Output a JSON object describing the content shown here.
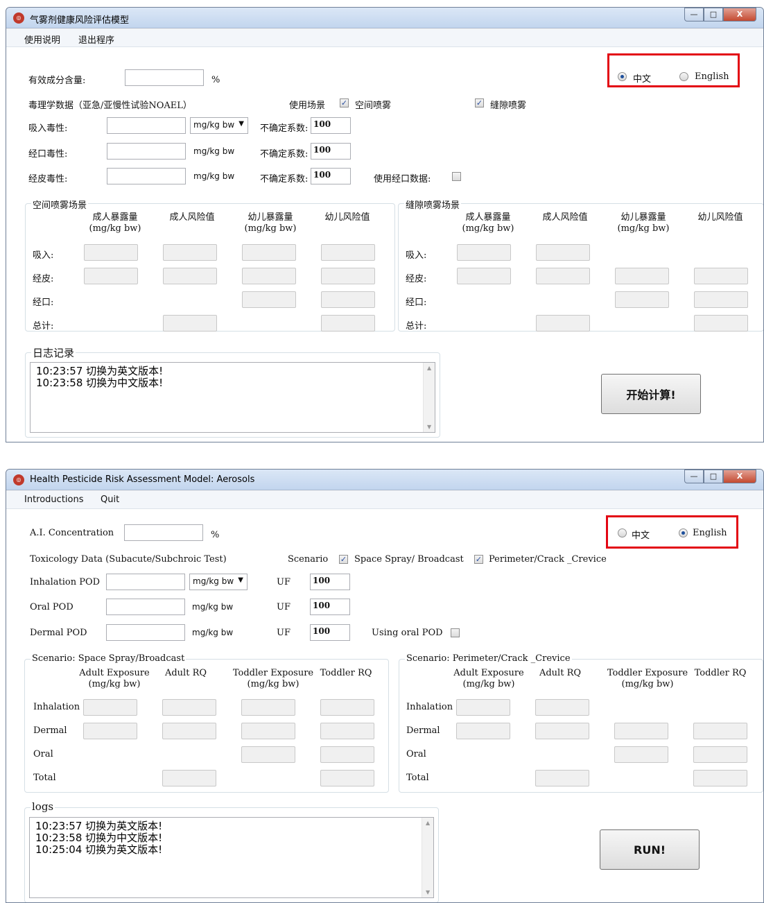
{
  "top": {
    "title": "气雾剂健康风险评估模型",
    "window_controls": {
      "min": "—",
      "max": "□",
      "close": "X"
    },
    "menu": [
      "使用说明",
      "退出程序"
    ],
    "ai_concentration": {
      "label": "有效成分含量:",
      "value": "",
      "unit": "%"
    },
    "lang": {
      "zh": "中文",
      "en": "English",
      "selected": "zh"
    },
    "tox_header": "毒理学数据（亚急/亚慢性试验NOAEL）",
    "scenario_label": "使用场景",
    "space_spray": "空间喷雾",
    "crack_spray": "缝隙喷雾",
    "inhalation": "吸入毒性:",
    "oral": "经口毒性:",
    "dermal": "经皮毒性:",
    "unit_combo": "mg/kg bw",
    "unit": "mg/kg bw",
    "uf_label": "不确定系数:",
    "uf_values": [
      "100",
      "100",
      "100"
    ],
    "use_oral": "使用经口数据:",
    "group1_title": "空间喷雾场景",
    "group2_title": "缝隙喷雾场景",
    "col_headers": [
      "成人暴露量\n(mg/kg bw)",
      "成人风险值",
      "幼儿暴露量\n(mg/kg bw)",
      "幼儿风险值"
    ],
    "row_labels": [
      "吸入:",
      "经皮:",
      "经口:",
      "总计:"
    ],
    "log_title": "日志记录",
    "logs": [
      "10:23:57 切换为英文版本!",
      "10:23:58 切换为中文版本!"
    ],
    "run": "开始计算!"
  },
  "bottom": {
    "title": "Health Pesticide Risk Assessment Model: Aerosols",
    "window_controls": {
      "min": "—",
      "max": "□",
      "close": "X"
    },
    "menu": [
      "Introductions",
      "Quit"
    ],
    "ai_concentration": {
      "label": "A.I. Concentration",
      "value": "",
      "unit": "%"
    },
    "lang": {
      "zh": "中文",
      "en": "English",
      "selected": "en"
    },
    "tox_header": "Toxicology Data (Subacute/Subchroic Test)",
    "scenario_label": "Scenario",
    "space_spray": "Space Spray/ Broadcast",
    "crack_spray": "Perimeter/Crack _Crevice",
    "inhalation": "Inhalation POD",
    "oral": "Oral POD",
    "dermal": "Dermal POD",
    "unit_combo": "mg/kg bw",
    "unit": "mg/kg bw",
    "uf_label": "UF",
    "uf_values": [
      "100",
      "100",
      "100"
    ],
    "use_oral": "Using oral POD",
    "group1_title": "Scenario: Space Spray/Broadcast",
    "group2_title": "Scenario: Perimeter/Crack _Crevice",
    "col_headers": [
      "Adult Exposure\n(mg/kg bw)",
      "Adult RQ",
      "Toddler Exposure\n(mg/kg bw)",
      "Toddler RQ"
    ],
    "row_labels": [
      "Inhalation",
      "Dermal",
      "Oral",
      "Total"
    ],
    "log_title": "logs",
    "logs": [
      "10:23:57 切换为英文版本!",
      "10:23:58 切换为中文版本!",
      "10:25:04 切换为英文版本!"
    ],
    "run": "RUN!"
  }
}
